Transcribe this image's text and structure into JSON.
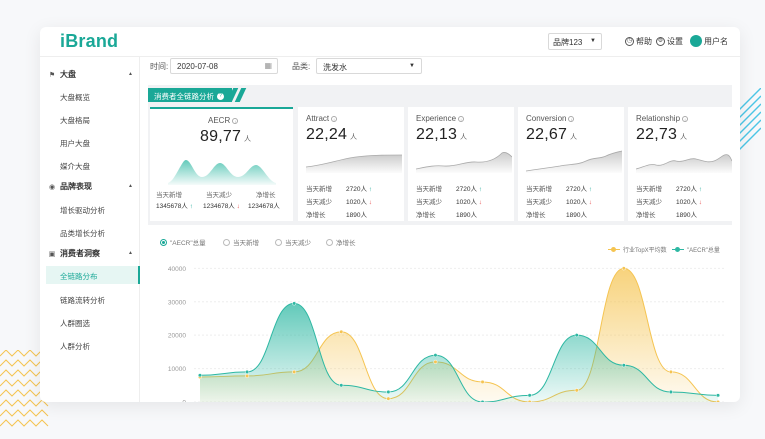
{
  "header": {
    "logo": "iBrand",
    "brand_select": "品牌123",
    "help": "帮助",
    "settings": "设置",
    "username": "用户名"
  },
  "sidebar": {
    "groups": [
      {
        "label": "大盘",
        "items": [
          "大盘概览",
          "大盘格局",
          "用户大盘",
          "媒介大盘"
        ]
      },
      {
        "label": "品牌表现",
        "items": [
          "增长驱动分析",
          "品类增长分析"
        ]
      },
      {
        "label": "消费者洞察",
        "items": [
          "全链路分布",
          "链路流转分析",
          "人群圈选",
          "人群分析"
        ]
      }
    ],
    "active_item": "全链路分布"
  },
  "filters": {
    "time_label": "时间:",
    "date_value": "2020-07-08",
    "category_label": "品类:",
    "category_value": "洗发水"
  },
  "section": {
    "title": "消费者全链路分析"
  },
  "cards": [
    {
      "title": "AECR",
      "value": "89,77",
      "unit": "人",
      "stats": {
        "l1": "当天新增",
        "l2": "当天减少",
        "l3": "净增长",
        "v1": "1345678人",
        "v2": "1234678人",
        "v3": "1234678人"
      }
    },
    {
      "title": "Attract",
      "value": "22,24",
      "unit": "人",
      "rows": [
        {
          "label": "当天新增",
          "value": "2720人",
          "dir": "up"
        },
        {
          "label": "当天减少",
          "value": "1020人",
          "dir": "down"
        },
        {
          "label": "净增长",
          "value": "1890人",
          "dir": ""
        }
      ]
    },
    {
      "title": "Experience",
      "value": "22,13",
      "unit": "人",
      "rows": [
        {
          "label": "当天新增",
          "value": "2720人",
          "dir": "up"
        },
        {
          "label": "当天减少",
          "value": "1020人",
          "dir": "down"
        },
        {
          "label": "净增长",
          "value": "1890人",
          "dir": ""
        }
      ]
    },
    {
      "title": "Conversion",
      "value": "22,67",
      "unit": "人",
      "rows": [
        {
          "label": "当天新增",
          "value": "2720人",
          "dir": "up"
        },
        {
          "label": "当天减少",
          "value": "1020人",
          "dir": "down"
        },
        {
          "label": "净增长",
          "value": "1890人",
          "dir": ""
        }
      ]
    },
    {
      "title": "Relationship",
      "value": "22,73",
      "unit": "人",
      "rows": [
        {
          "label": "当天新增",
          "value": "2720人",
          "dir": "up"
        },
        {
          "label": "当天减少",
          "value": "1020人",
          "dir": "down"
        },
        {
          "label": "净增长",
          "value": "1890人",
          "dir": ""
        }
      ]
    }
  ],
  "chart_controls": {
    "radios": [
      "\"AECR\"总量",
      "当天新增",
      "当天减少",
      "净增长"
    ],
    "selected": 0,
    "legend": [
      {
        "name": "行业TopX平均数",
        "color": "#f5c451"
      },
      {
        "name": "\"AECR\"总量",
        "color": "#2eb8a3"
      }
    ]
  },
  "colors": {
    "accent": "#1aa897",
    "orange": "#f5c451"
  },
  "chart_data": {
    "type": "area",
    "y_ticks": [
      0,
      10000,
      20000,
      30000,
      40000
    ],
    "ylim": [
      0,
      41000
    ],
    "series": [
      {
        "name": "行业TopX平均数",
        "color": "#f5c451",
        "values": [
          7500,
          7800,
          9000,
          21000,
          1000,
          12000,
          6000,
          0,
          3500,
          40000,
          9000,
          0
        ]
      },
      {
        "name": "\"AECR\"总量",
        "color": "#2eb8a3",
        "values": [
          8000,
          9000,
          29500,
          5000,
          3000,
          14000,
          0,
          2000,
          20000,
          11000,
          3000,
          2000
        ]
      }
    ]
  }
}
